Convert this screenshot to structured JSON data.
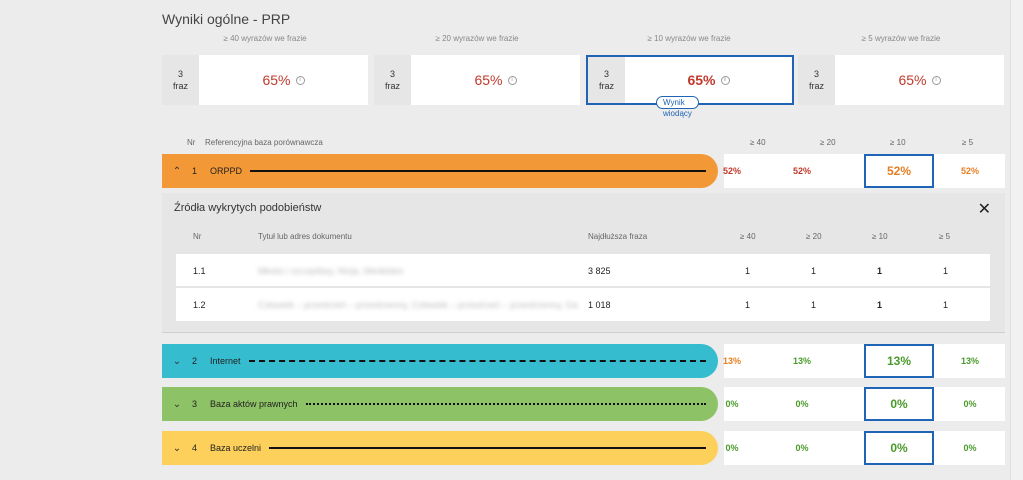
{
  "title": "Wyniki ogólne - PRP",
  "cards": [
    {
      "label": "≥ 40 wyrazów we frazie",
      "count": "3",
      "unit": "fraz",
      "pct": "65%"
    },
    {
      "label": "≥ 20 wyrazów we frazie",
      "count": "3",
      "unit": "fraz",
      "pct": "65%"
    },
    {
      "label": "≥ 10 wyrazów we frazie",
      "count": "3",
      "unit": "fraz",
      "pct": "65%"
    },
    {
      "label": "≥ 5 wyrazów we frazie",
      "count": "3",
      "unit": "fraz",
      "pct": "65%"
    }
  ],
  "lead_badge": "Wynik wiodący",
  "info_glyph": "i",
  "table_header": {
    "nr": "Nr",
    "base": "Referencyjna baza porównawcza",
    "c40": "≥ 40",
    "c20": "≥ 20",
    "c10": "≥ 10",
    "c5": "≥ 5"
  },
  "rows": [
    {
      "chev": "⌃",
      "nr": "1",
      "name": "ORPPD",
      "v40": "52%",
      "v20": "52%",
      "v10": "52%",
      "v5": "52%",
      "color": "#f39837"
    },
    {
      "chev": "⌄",
      "nr": "2",
      "name": "Internet",
      "v40": "13%",
      "v20": "13%",
      "v10": "13%",
      "v5": "13%",
      "color": "#35bccf"
    },
    {
      "chev": "⌄",
      "nr": "3",
      "name": "Baza aktów prawnych",
      "v40": "0%",
      "v20": "0%",
      "v10": "0%",
      "v5": "0%",
      "color": "#8dc366"
    },
    {
      "chev": "⌄",
      "nr": "4",
      "name": "Baza uczelni",
      "v40": "0%",
      "v20": "0%",
      "v10": "0%",
      "v5": "0%",
      "color": "#fdd05c"
    }
  ],
  "sources": {
    "title": "Źródła wykrytych podobieństw",
    "close": "✕",
    "headers": {
      "nr": "Nr",
      "doc": "Tytuł lub adres dokumentu",
      "longest": "Najdłuższa fraza",
      "c40": "≥ 40",
      "c20": "≥ 20",
      "c10": "≥ 10",
      "c5": "≥ 5"
    },
    "rows": [
      {
        "nr": "1.1",
        "doc": "Młodzi i szczęśliwy, Ninja, Wedeldes",
        "longest": "3 825",
        "c40": "1",
        "c20": "1",
        "c10": "1",
        "c5": "1"
      },
      {
        "nr": "1.2",
        "doc": "Człowiek – przestrzeń – przestrzenny, Człowiek – przestrzeń – przestrzenny, Gabriel...",
        "longest": "1 018",
        "c40": "1",
        "c20": "1",
        "c10": "1",
        "c5": "1"
      }
    ]
  }
}
